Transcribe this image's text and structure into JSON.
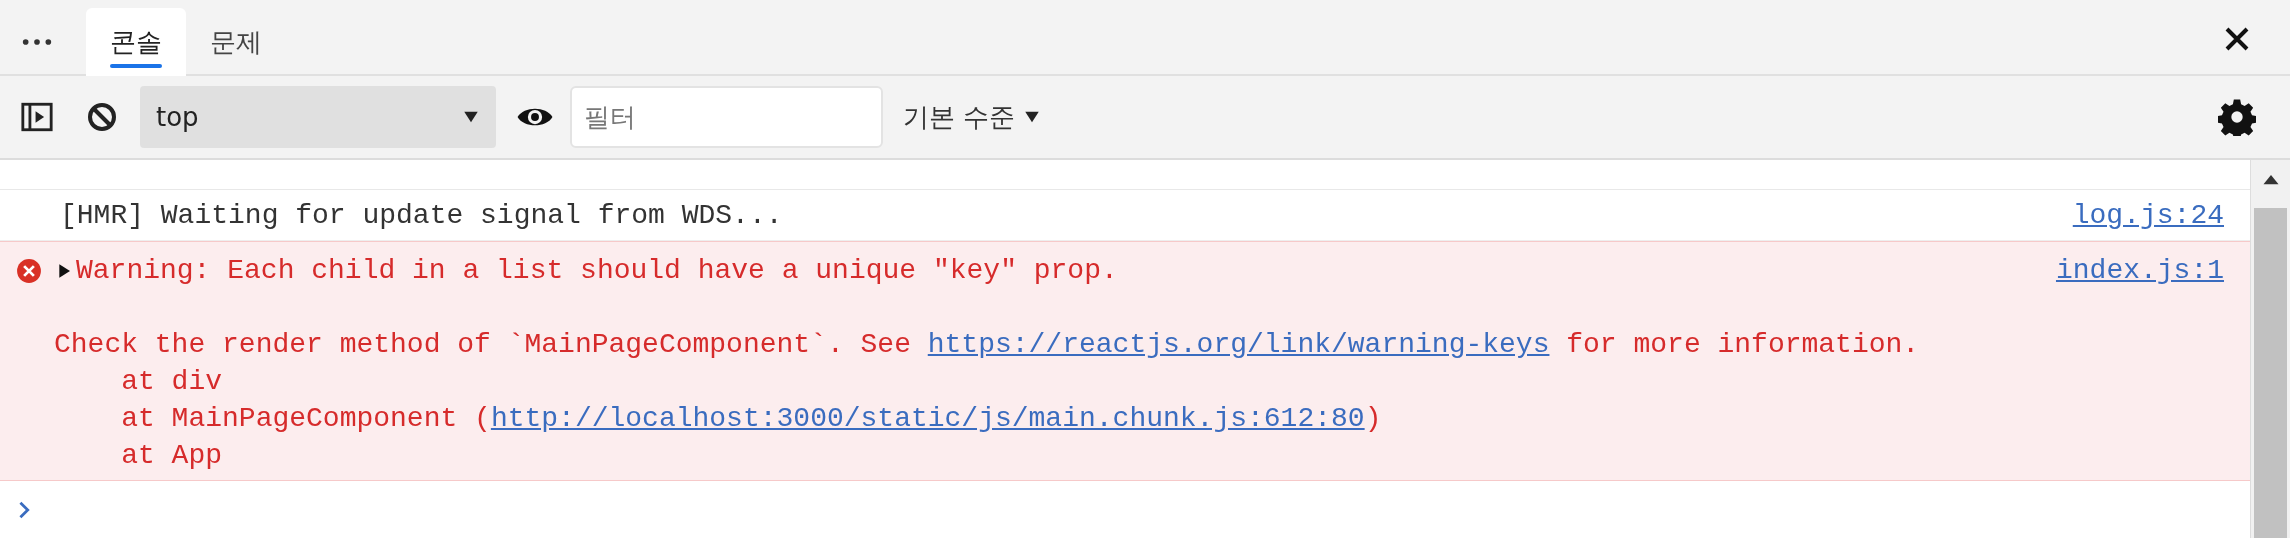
{
  "tabs": [
    {
      "label": "콘솔",
      "selected": true
    },
    {
      "label": "문제",
      "selected": false
    }
  ],
  "toolbar": {
    "context": "top",
    "filter": {
      "placeholder": "필터"
    },
    "levels": "기본 수준"
  },
  "messages": [
    {
      "kind": "log",
      "text": "[HMR] Waiting for update signal from WDS...",
      "source": "log.js:24"
    },
    {
      "kind": "error",
      "expanded": false,
      "source": "index.js:1",
      "lines": [
        [
          {
            "kind": "text",
            "text": "Warning: Each child in a list should have a unique \"key\" prop."
          }
        ],
        [
          {
            "kind": "spacer"
          },
          {
            "kind": "text",
            "text": "Check the render method of `MainPageComponent`. See "
          },
          {
            "kind": "link",
            "text": "https://reactjs.org/link/warning-keys"
          },
          {
            "kind": "text",
            "text": " for more information."
          }
        ],
        [
          {
            "kind": "text",
            "text": "    at div"
          }
        ],
        [
          {
            "kind": "text",
            "text": "    at MainPageComponent ("
          },
          {
            "kind": "link",
            "text": "http://localhost:3000/static/js/main.chunk.js:612:80"
          },
          {
            "kind": "text",
            "text": ")"
          }
        ],
        [
          {
            "kind": "text",
            "text": "    at App"
          }
        ]
      ]
    }
  ]
}
